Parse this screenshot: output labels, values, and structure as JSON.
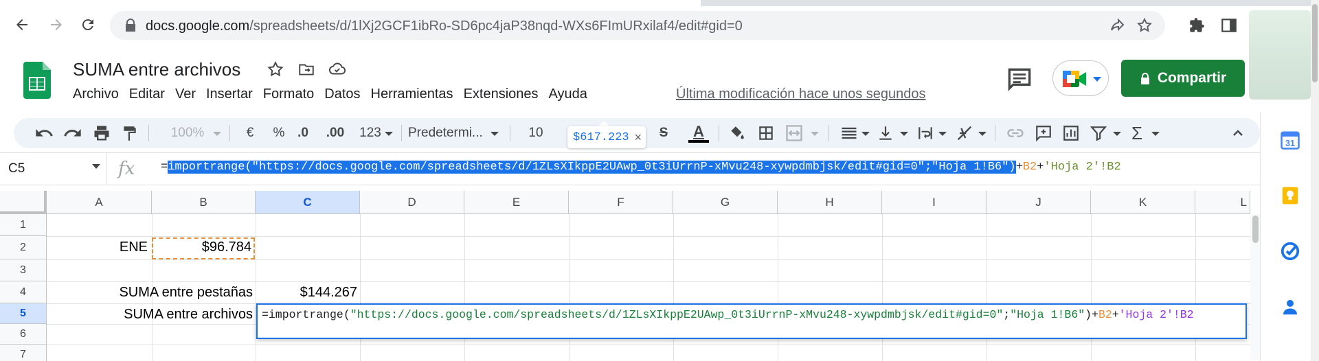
{
  "browser": {
    "url_host": "docs.google.com",
    "url_path": "/spreadsheets/d/1lXj2GCF1ibRo-SD6pc4jaP38nqd-WXs6FImURxilaf4/edit#gid=0"
  },
  "doc": {
    "title": "SUMA entre archivos",
    "last_edit": "Última modificación hace unos segundos",
    "share_label": "Compartir"
  },
  "menu": [
    "Archivo",
    "Editar",
    "Ver",
    "Insertar",
    "Formato",
    "Datos",
    "Herramientas",
    "Extensiones",
    "Ayuda"
  ],
  "toolbar": {
    "zoom": "100%",
    "currency": "€",
    "percent": "%",
    "dec_decrease": ".0",
    "dec_increase": ".00",
    "more_formats": "123",
    "font": "Predetermi...",
    "font_size": "10",
    "strikethrough": "S",
    "text_color": "A"
  },
  "tooltip": {
    "value": "$617.223",
    "close": "×"
  },
  "formula_bar": {
    "cell_ref": "C5",
    "fx": "fx",
    "eq": "=",
    "selected": "importrange(\"https://docs.google.com/spreadsheets/d/1ZLsXIkppE2UAwp_0t3iUrrnP-xMvu248-xywpdmbjsk/edit#gid=0\";\"Hoja 1!B6\")",
    "plus1": "+",
    "ref1": "B2",
    "plus2": "+",
    "ref2": "'Hoja 2'!B2"
  },
  "grid": {
    "columns": [
      "A",
      "B",
      "C",
      "D",
      "E",
      "F",
      "G",
      "H",
      "I",
      "J",
      "K",
      "L"
    ],
    "rows": [
      "1",
      "2",
      "3",
      "4",
      "5",
      "6",
      "7"
    ],
    "cells": {
      "A2": "ENE",
      "B2": "$96.784",
      "A4": "SUMA entre pestañas",
      "C4": "$144.267",
      "A5": "SUMA entre archivos"
    }
  },
  "editor": {
    "eq": "=",
    "func": "importrange(",
    "url": "\"https://docs.google.com/spreadsheets/d/1ZLsXIkppE2UAwp_0t3iUrrnP-xMvu248-xywpdmbjsk/edit#gid=0\"",
    "sep": ";",
    "range": "\"Hoja 1!B6\"",
    "close": ")+",
    "ref1": "B2",
    "plus": "+",
    "ref2": "'Hoja 2'!B2"
  },
  "colors": {
    "share_green": "#188038",
    "selection_blue": "#1a73e8",
    "ref_orange": "#e69138",
    "ref_purple": "#9334e6",
    "string_green": "#188038"
  }
}
